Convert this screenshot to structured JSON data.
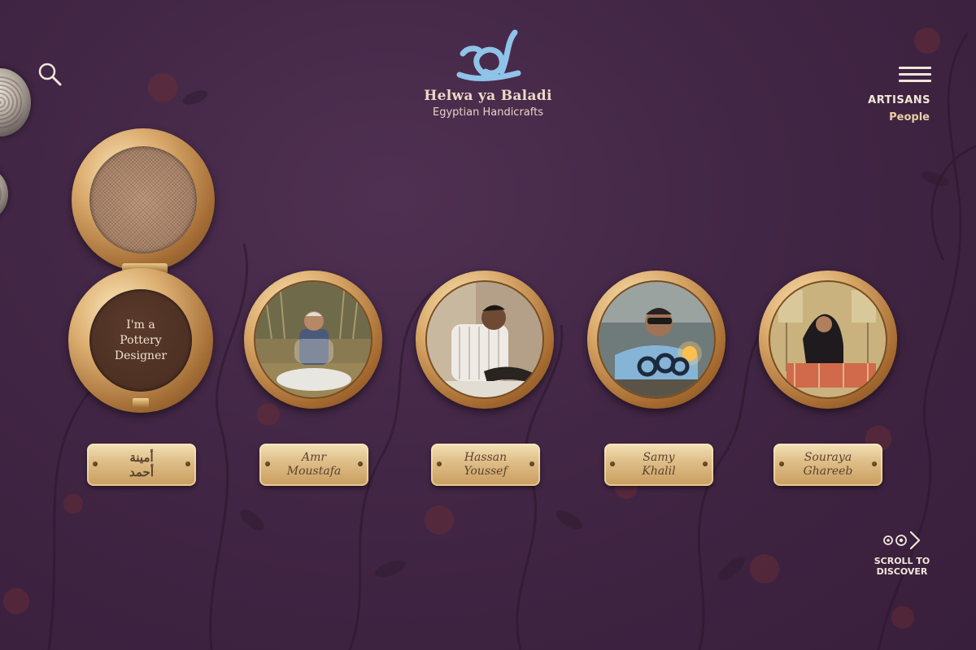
{
  "app": {
    "brand_name": "Helwa ya Baladi",
    "tagline": "Egyptian Handicrafts",
    "logo_icon": "calligraphy-logo-icon",
    "accent_color": "#8fc3e8"
  },
  "header": {
    "search_icon": "search-icon",
    "menu_icon": "hamburger-menu-icon",
    "section_title": "ARTISANS",
    "section_subtitle": "People"
  },
  "featured": {
    "caption": "I'm a\nPottery\nDesigner",
    "name": "أمينة\nأحمد"
  },
  "artisans": [
    {
      "name": "Amr\nMoustafa",
      "photo_icon": "artisan-weaving-photo"
    },
    {
      "name": "Hassan\nYoussef",
      "photo_icon": "artisan-carving-photo"
    },
    {
      "name": "Samy\nKhalil",
      "photo_icon": "artisan-glassblowing-photo"
    },
    {
      "name": "Souraya\nGhareeb",
      "photo_icon": "artisan-loom-photo"
    }
  ],
  "footer": {
    "scroll_label": "SCROLL TO\nDISCOVER",
    "scroll_icon": "scroll-right-icon"
  },
  "colors": {
    "background": "#432646",
    "gold": "#d9a86a",
    "text_light": "#f3e7d8"
  }
}
